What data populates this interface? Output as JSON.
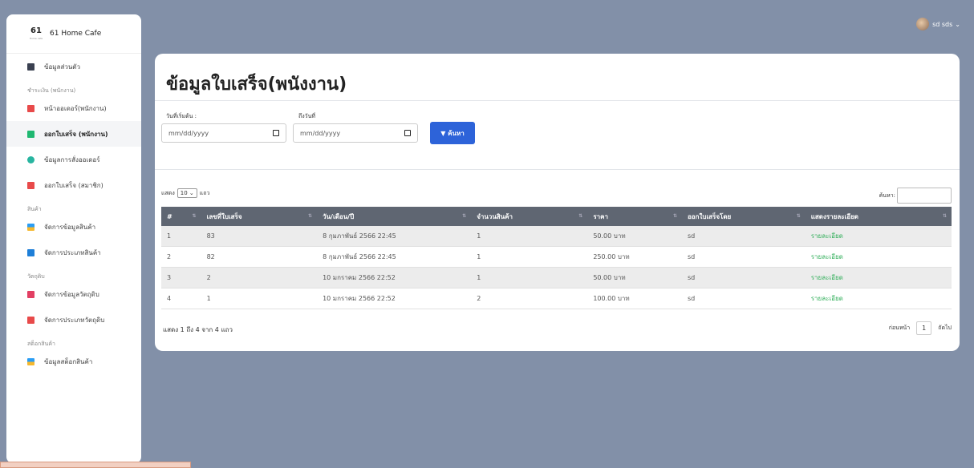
{
  "sidebar": {
    "logo_mark": "61",
    "logo_sub": "Home cafe",
    "brand": "61 Home Cafe",
    "items": [
      {
        "type": "item",
        "label": "ข้อมูลส่วนตัว",
        "icon": "id-card-icon",
        "color": "dark"
      },
      {
        "type": "head",
        "label": "ชำระเงิน (พนักงาน)"
      },
      {
        "type": "item",
        "label": "หน้าออเดอร์(พนักงาน)",
        "icon": "book-icon",
        "color": "red"
      },
      {
        "type": "item",
        "label": "ออกใบเสร็จ (พนักงาน)",
        "icon": "receipt-icon",
        "color": "green",
        "active": true
      },
      {
        "type": "item",
        "label": "ข้อมูลการสั่งออเดอร์",
        "icon": "users-icon",
        "color": "teal"
      },
      {
        "type": "item",
        "label": "ออกใบเสร็จ (สมาชิก)",
        "icon": "book-icon",
        "color": "red"
      },
      {
        "type": "head",
        "label": "สินค้า"
      },
      {
        "type": "item",
        "label": "จัดการข้อมูลสินค้า",
        "icon": "cubes-icon",
        "color": "cubes"
      },
      {
        "type": "item",
        "label": "จัดการประเภทสินค้า",
        "icon": "book-icon",
        "color": "blue"
      },
      {
        "type": "head",
        "label": "วัตถุดิบ"
      },
      {
        "type": "item",
        "label": "จัดการข้อมูลวัตถุดิบ",
        "icon": "box-icon",
        "color": "pink"
      },
      {
        "type": "item",
        "label": "จัดการประเภทวัตถุดิบ",
        "icon": "book-icon",
        "color": "red"
      },
      {
        "type": "head",
        "label": "สต็อกสินค้า"
      },
      {
        "type": "item",
        "label": "ข้อมูลสต็อกสินค้า",
        "icon": "cubes-icon",
        "color": "cubes"
      }
    ]
  },
  "user": {
    "name": "sd sds",
    "caret": "⌄"
  },
  "page": {
    "title": "ข้อมูลใบเสร็จ(พนังงาน)",
    "start_label": "วันที่เริ่มต้น :",
    "end_label": "ถึงวันที่",
    "start_placeholder": "mm/dd/yyyy",
    "end_placeholder": "mm/dd/yyyy",
    "search_button": "ค้นหา",
    "length_prefix": "แสดง",
    "length_value": "10",
    "length_suffix": "แถว",
    "search_label": "ค้นหา:",
    "info": "แสดง 1 ถึง 4 จาก 4 แถว",
    "prev": "ก่อนหน้า",
    "page_num": "1",
    "next": "ถัดไป"
  },
  "table": {
    "headers": [
      "#",
      "เลขที่ใบเสร็จ",
      "วัน/เดือน/ปี",
      "จำนวนสินค้า",
      "ราคา",
      "ออกใบเสร็จโดย",
      "แสดงรายละเอียด"
    ],
    "rows": [
      [
        "1",
        "83",
        "8 กุมภาพันธ์ 2566 22:45",
        "1",
        "50.00 บาท",
        "sd",
        "รายละเอียด"
      ],
      [
        "2",
        "82",
        "8 กุมภาพันธ์ 2566 22:45",
        "1",
        "250.00 บาท",
        "sd",
        "รายละเอียด"
      ],
      [
        "3",
        "2",
        "10 มกราคม 2566 22:52",
        "1",
        "50.00 บาท",
        "sd",
        "รายละเอียด"
      ],
      [
        "4",
        "1",
        "10 มกราคม 2566 22:52",
        "2",
        "100.00 บาท",
        "sd",
        "รายละเอียด"
      ]
    ]
  }
}
